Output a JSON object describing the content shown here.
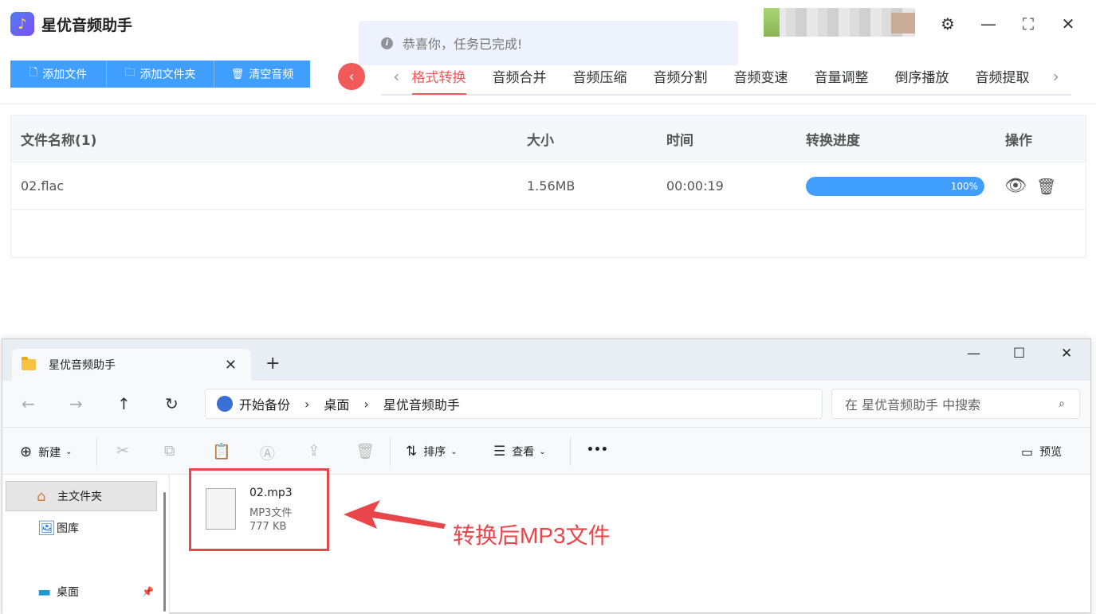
{
  "app": {
    "title": "星优音频助手",
    "toast": "恭喜你，任务已完成!",
    "toolbar": {
      "add_file": "添加文件",
      "add_folder": "添加文件夹",
      "clear_audio": "清空音频"
    },
    "tabs": [
      "格式转换",
      "音频合并",
      "音频压缩",
      "音频分割",
      "音频变速",
      "音量调整",
      "倒序播放",
      "音频提取"
    ],
    "active_tab": "格式转换",
    "table": {
      "headers": [
        "文件名称(1)",
        "大小",
        "时间",
        "转换进度",
        "操作"
      ],
      "rows": [
        {
          "name": "02.flac",
          "size": "1.56MB",
          "time": "00:00:19",
          "progress": "100%",
          "progress_value": 100
        }
      ]
    },
    "colors": {
      "accent": "#409eff",
      "active_tab": "#f05a5a"
    }
  },
  "explorer": {
    "tab_title": "星优音频助手",
    "breadcrumb": [
      "开始备份",
      "桌面",
      "星优音频助手"
    ],
    "search_placeholder": "在 星优音频助手 中搜索",
    "commands": {
      "new": "新建",
      "sort": "排序",
      "view": "查看",
      "more": "•••",
      "preview": "预览"
    },
    "sidebar": [
      "主文件夹",
      "图库",
      "桌面"
    ],
    "file": {
      "name": "02.mp3",
      "type": "MP3文件",
      "size": "777 KB"
    },
    "annotation": "转换后MP3文件",
    "colors": {
      "annotation": "#e8464a"
    }
  }
}
